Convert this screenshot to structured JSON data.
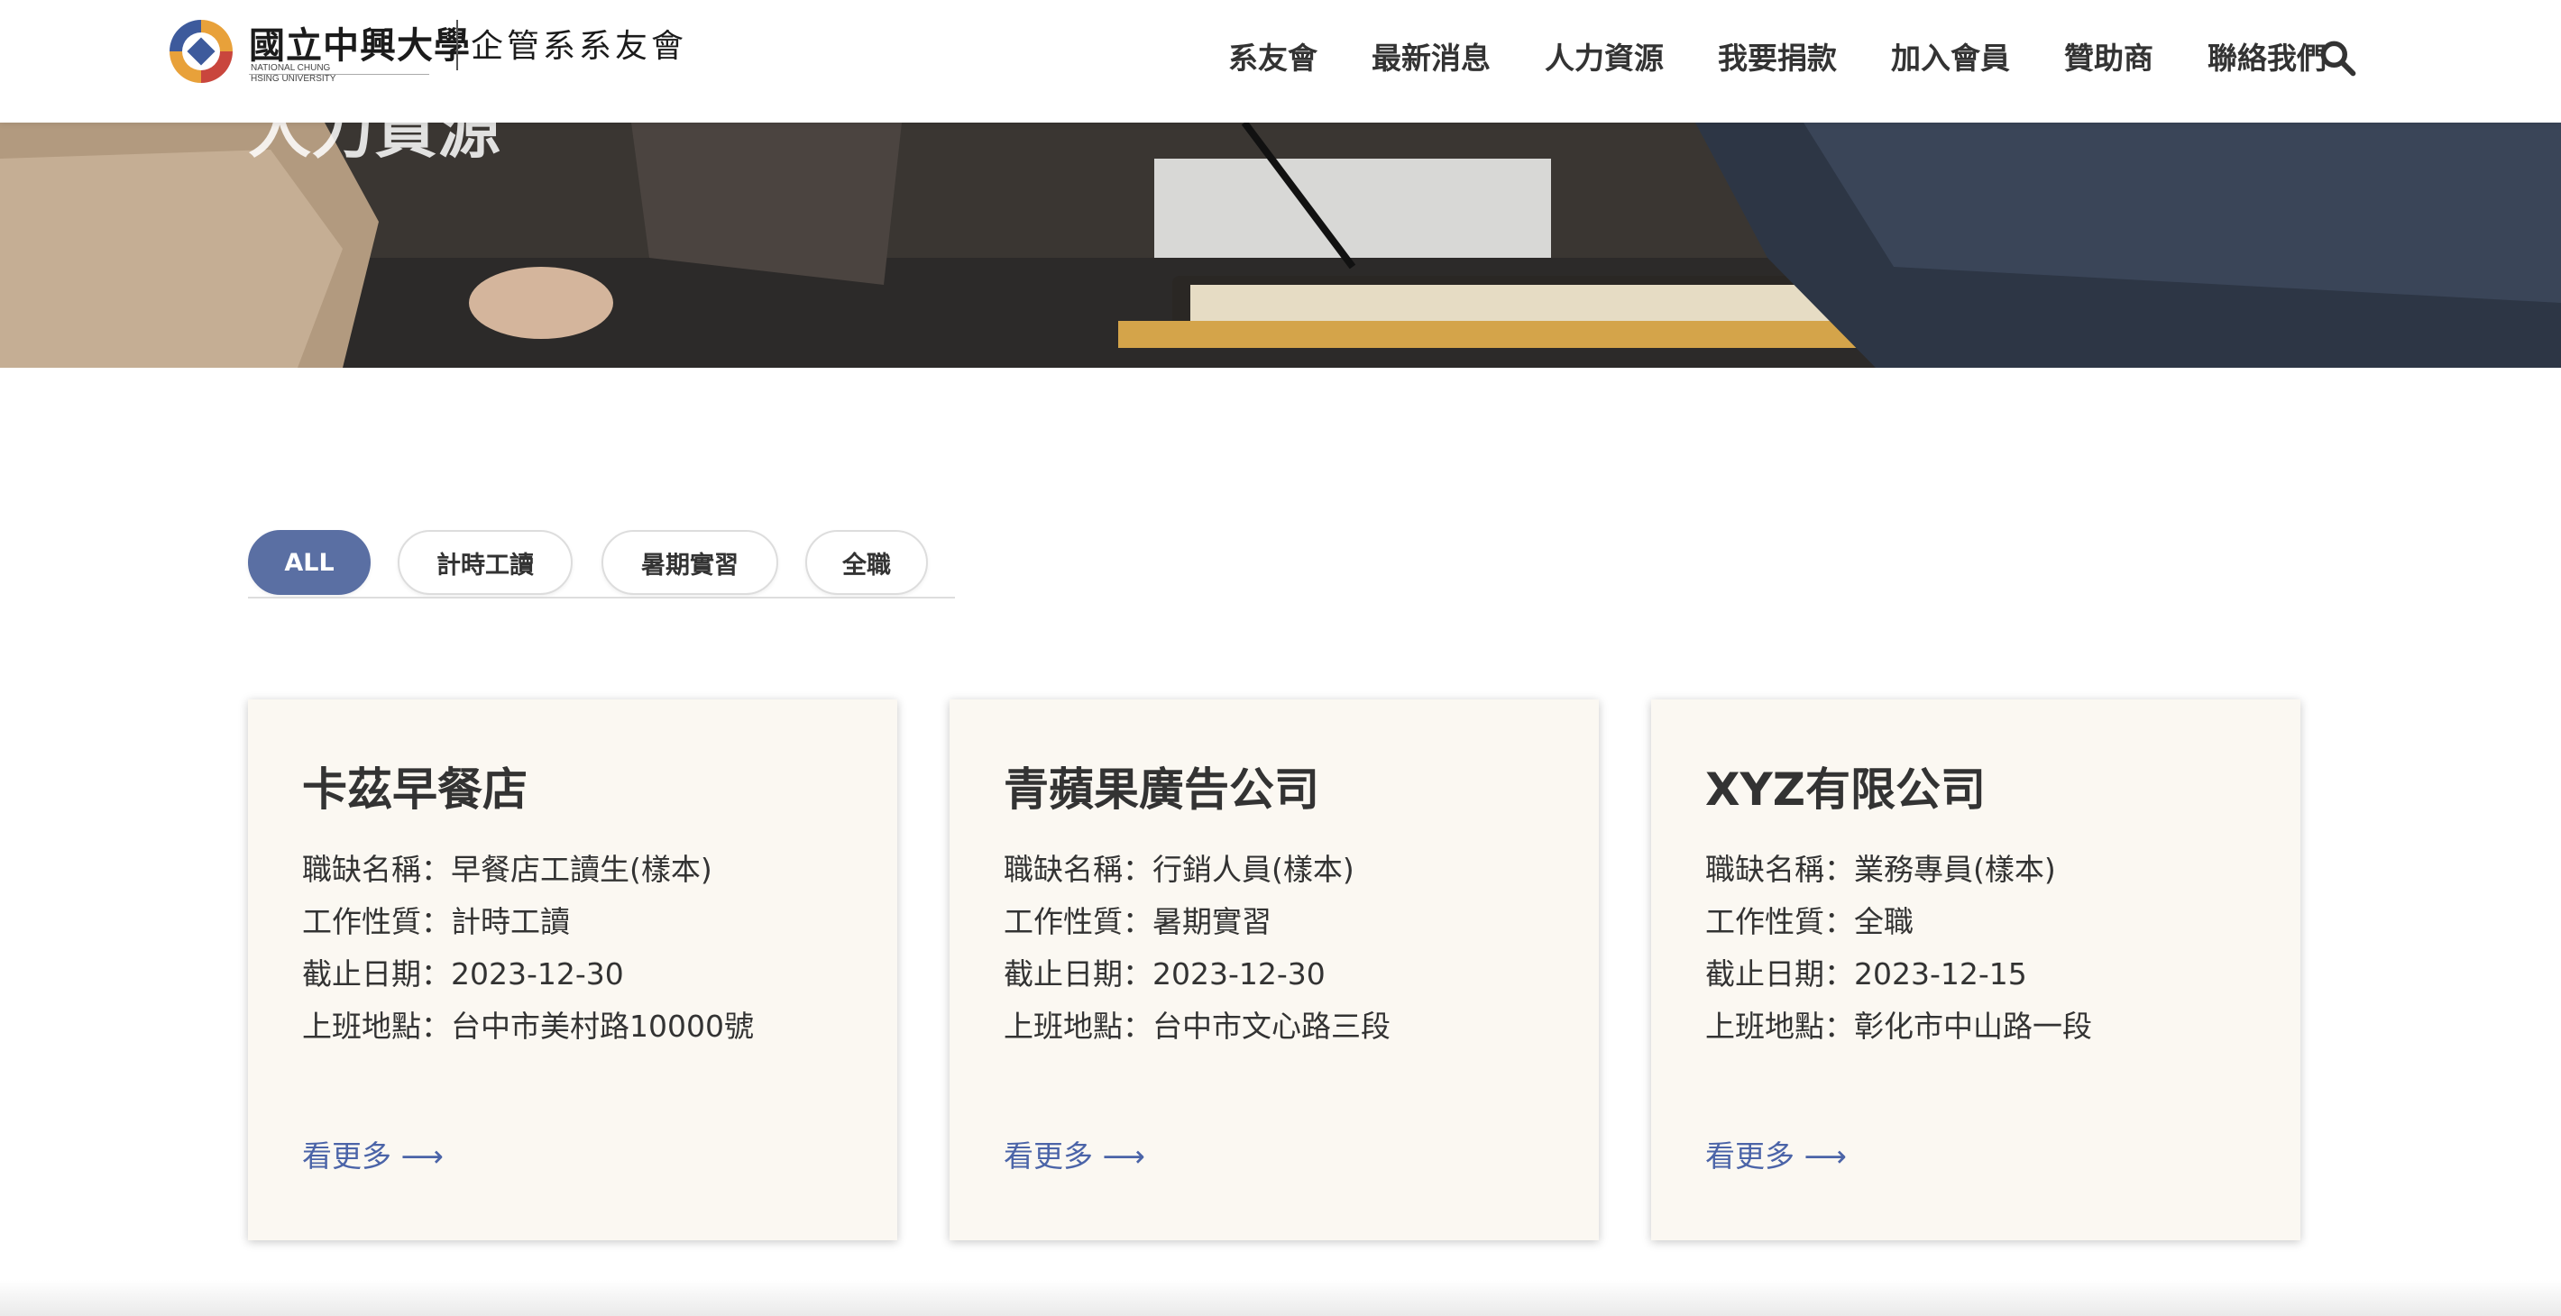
{
  "header": {
    "logo_university": "國立中興大學",
    "logo_university_en": "NATIONAL CHUNG HSING UNIVERSITY",
    "logo_association": "企管系系友會",
    "nav": [
      {
        "label": "系友會"
      },
      {
        "label": "最新消息"
      },
      {
        "label": "人力資源"
      },
      {
        "label": "我要捐款"
      },
      {
        "label": "加入會員"
      },
      {
        "label": "贊助商"
      },
      {
        "label": "聯絡我們"
      }
    ],
    "search_icon": "search-icon"
  },
  "hero": {
    "title": "人力資源"
  },
  "filters": {
    "tabs": [
      {
        "label": "ALL",
        "active": true
      },
      {
        "label": "計時工讀",
        "active": false
      },
      {
        "label": "暑期實習",
        "active": false
      },
      {
        "label": "全職",
        "active": false
      }
    ]
  },
  "jobs": [
    {
      "company": "卡茲早餐店",
      "title_row": "職缺名稱：早餐店工讀生(樣本)",
      "type_row": "工作性質：計時工讀",
      "deadline_row": "截止日期：2023-12-30",
      "location_row": "上班地點：台中市美村路10000號",
      "more": "看更多 ⟶"
    },
    {
      "company": "青蘋果廣告公司",
      "title_row": "職缺名稱：行銷人員(樣本)",
      "type_row": "工作性質：暑期實習",
      "deadline_row": "截止日期：2023-12-30",
      "location_row": "上班地點：台中市文心路三段",
      "more": "看更多 ⟶"
    },
    {
      "company": "XYZ有限公司",
      "title_row": "職缺名稱：業務專員(樣本)",
      "type_row": "工作性質：全職",
      "deadline_row": "截止日期：2023-12-15",
      "location_row": "上班地點：彰化市中山路一段",
      "more": "看更多 ⟶"
    }
  ],
  "colors": {
    "accent": "#5a6fa3",
    "link": "#4b64a8",
    "card_bg": "#fbf8f2"
  }
}
